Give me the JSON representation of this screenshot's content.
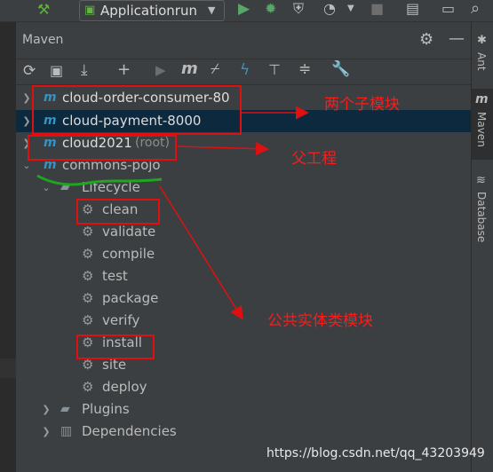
{
  "toolbar": {
    "run_config": "Applicationrun"
  },
  "panel": {
    "title": "Maven"
  },
  "side_tabs": {
    "ant": "Ant",
    "maven": "Maven",
    "database": "Database"
  },
  "tree": {
    "modules": [
      {
        "label": "cloud-order-consumer-80",
        "suffix": ""
      },
      {
        "label": "cloud-payment-8000",
        "suffix": ""
      },
      {
        "label": "cloud2021",
        "suffix": "(root)"
      },
      {
        "label": "commons-pojo",
        "suffix": ""
      }
    ],
    "lifecycle_label": "Lifecycle",
    "lifecycle": [
      "clean",
      "validate",
      "compile",
      "test",
      "package",
      "verify",
      "install",
      "site",
      "deploy"
    ],
    "plugins_label": "Plugins",
    "dependencies_label": "Dependencies"
  },
  "annotations": {
    "two_modules": "两个子模块",
    "parent_project": "父工程",
    "common_entity": "公共实体类模块"
  },
  "watermark": "https://blog.csdn.net/qq_43203949",
  "colors": {
    "panel_bg": "#3c3f41",
    "selection": "#0d293e",
    "annotation_red": "#e01010",
    "underline_green": "#1fa51f"
  }
}
